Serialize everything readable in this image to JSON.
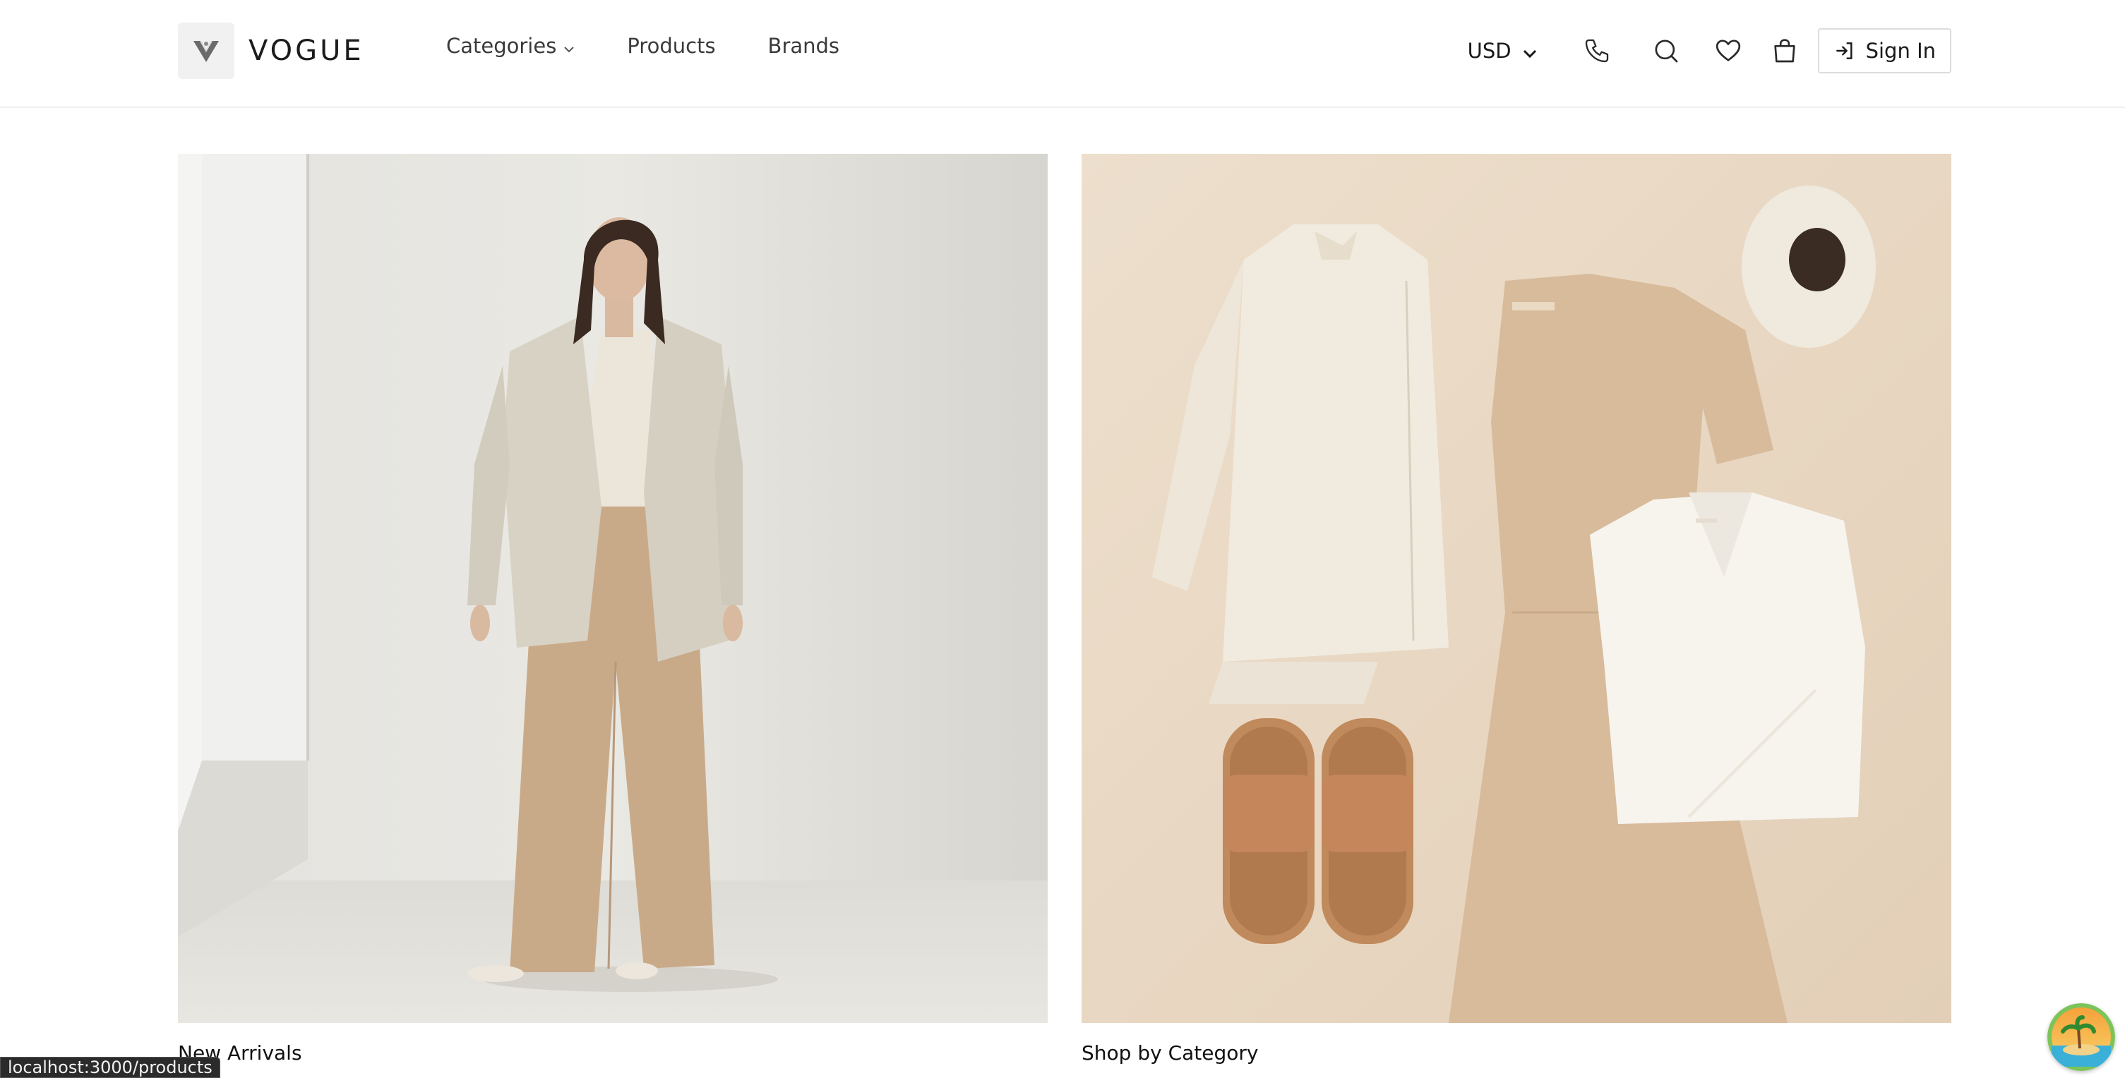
{
  "brand": {
    "name": "VOGUE"
  },
  "nav": {
    "items": [
      {
        "label": "Categories",
        "has_dropdown": true
      },
      {
        "label": "Products",
        "has_dropdown": false
      },
      {
        "label": "Brands",
        "has_dropdown": false
      }
    ]
  },
  "header_actions": {
    "currency": "USD",
    "icons": [
      "phone-icon",
      "search-icon",
      "heart-icon",
      "shopping-bag-icon"
    ],
    "sign_in_label": "Sign In"
  },
  "cards": [
    {
      "label": "New Arrivals",
      "image": "woman-in-linen-blazer-photo"
    },
    {
      "label": "Shop by Category",
      "image": "flat-lay-clothing-photo"
    }
  ],
  "status_bar": {
    "url": "localhost:3000/products"
  },
  "colors": {
    "accent": "#1a1a1a",
    "beige": "#d8bc9c",
    "cream": "#efe8dc"
  }
}
